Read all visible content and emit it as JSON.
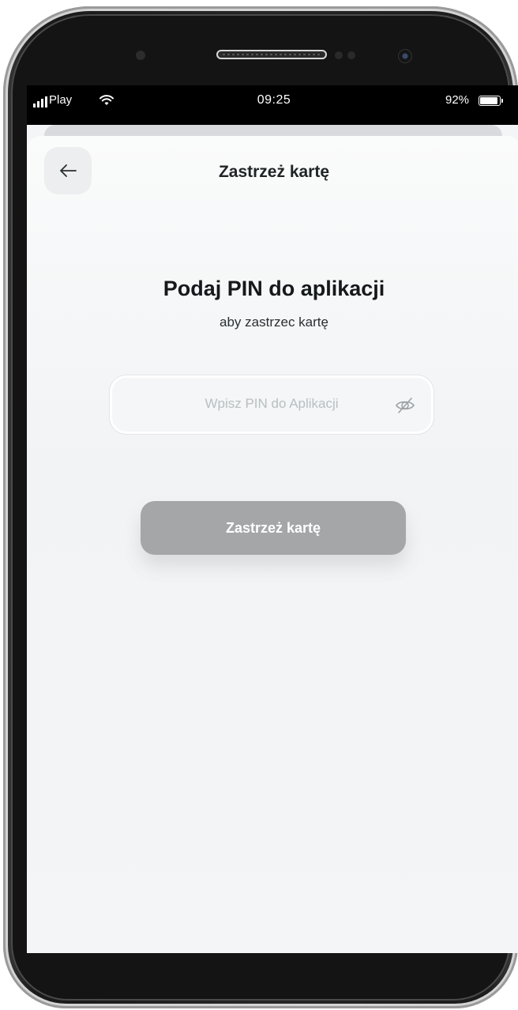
{
  "status_bar": {
    "carrier": "Play",
    "time": "09:25",
    "battery_percent_label": "92%",
    "battery_level": 0.92,
    "wifi_icon": "wifi-icon",
    "signal_icon": "cellular-signal-icon"
  },
  "header": {
    "title": "Zastrzeż kartę",
    "back_icon": "arrow-left-icon"
  },
  "prompt": {
    "title": "Podaj PIN do aplikacji",
    "subtitle": "aby zastrzec kartę"
  },
  "pin_field": {
    "placeholder": "Wpisz PIN do Aplikacji",
    "value": "",
    "toggle_icon": "eye-off-icon"
  },
  "submit": {
    "label": "Zastrzeż kartę",
    "enabled": false
  },
  "colors": {
    "background": "#f3f5f7",
    "button_disabled": "#a4a6a8",
    "text_primary": "#15191c",
    "placeholder": "#b9bec2"
  }
}
